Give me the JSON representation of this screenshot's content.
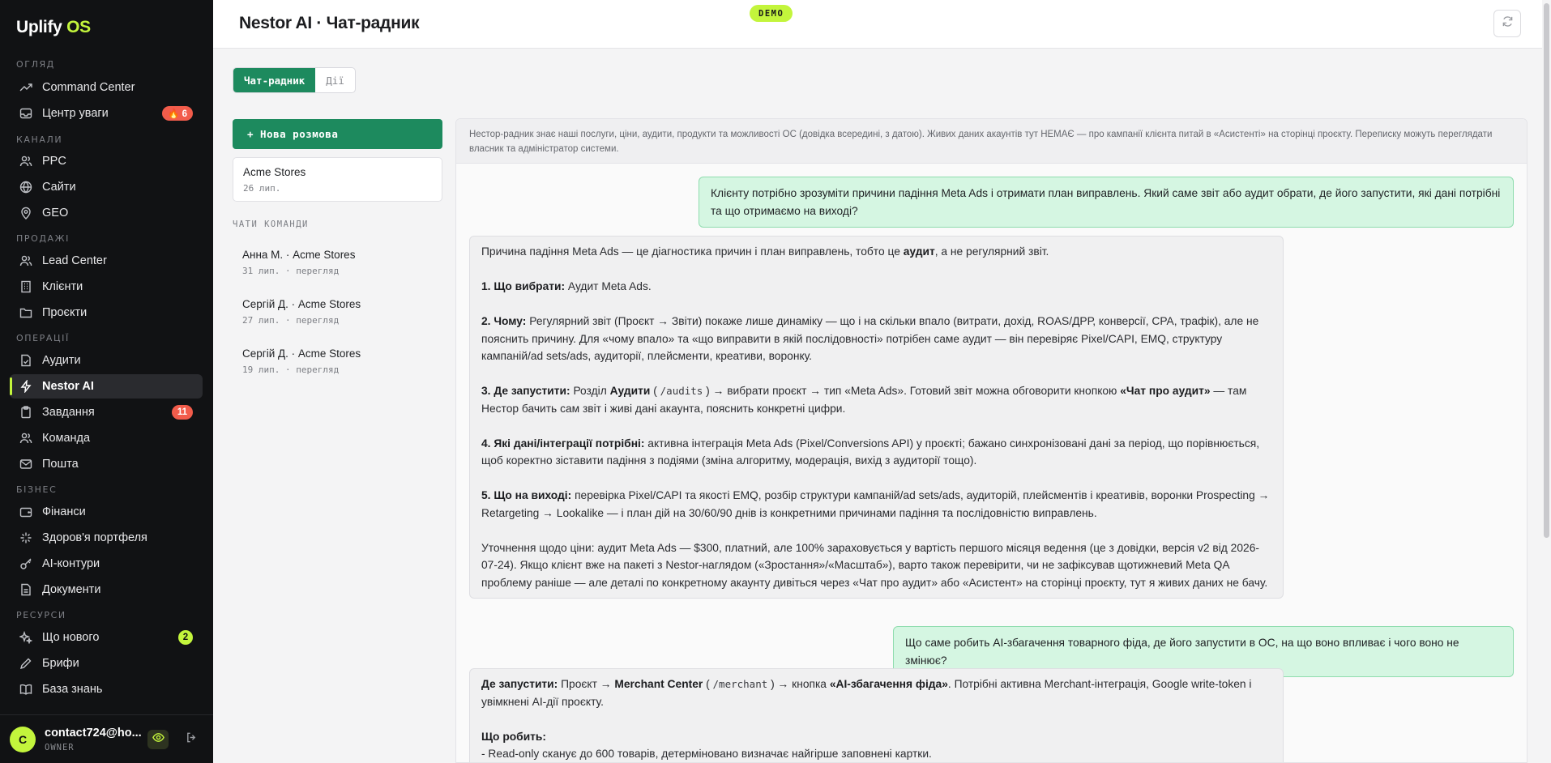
{
  "brand": {
    "name": "Uplify",
    "suffix": "OS"
  },
  "sidebar": {
    "sections": [
      {
        "label": "ОГЛЯД"
      },
      {
        "label": "КАНАЛИ"
      },
      {
        "label": "ПРОДАЖІ"
      },
      {
        "label": "ОПЕРАЦІЇ"
      },
      {
        "label": "БІЗНЕС"
      },
      {
        "label": "РЕСУРСИ"
      }
    ],
    "items": [
      {
        "label": "Command Center",
        "icon": "trending-up-icon"
      },
      {
        "label": "Центр уваги",
        "icon": "inbox-icon",
        "badge": "🔥 6"
      },
      {
        "label": "PPC",
        "icon": "users-icon"
      },
      {
        "label": "Сайти",
        "icon": "globe-icon"
      },
      {
        "label": "GEO",
        "icon": "map-pin-icon"
      },
      {
        "label": "Lead Center",
        "icon": "users-icon"
      },
      {
        "label": "Клієнти",
        "icon": "building-icon"
      },
      {
        "label": "Проєкти",
        "icon": "folder-icon"
      },
      {
        "label": "Аудити",
        "icon": "file-check-icon"
      },
      {
        "label": "Nestor AI",
        "icon": "bolt-icon",
        "active": true
      },
      {
        "label": "Завдання",
        "icon": "clipboard-icon",
        "badge": "11"
      },
      {
        "label": "Команда",
        "icon": "users-icon"
      },
      {
        "label": "Пошта",
        "icon": "mail-icon"
      },
      {
        "label": "Фінанси",
        "icon": "wallet-icon"
      },
      {
        "label": "Здоров'я портфеля",
        "icon": "sparkle-icon"
      },
      {
        "label": "AI-контури",
        "icon": "key-icon"
      },
      {
        "label": "Документи",
        "icon": "document-icon"
      },
      {
        "label": "Що нового",
        "icon": "sparkles-icon",
        "badge": "2"
      },
      {
        "label": "Брифи",
        "icon": "edit-icon"
      },
      {
        "label": "База знань",
        "icon": "book-icon"
      }
    ]
  },
  "account": {
    "initial": "C",
    "name": "contact724@ho...",
    "role": "OWNER"
  },
  "header": {
    "title": "Nestor AI · Чат-радник",
    "demo_label": "DEMO"
  },
  "tabs": [
    {
      "label": "Чат-радник",
      "active": true
    },
    {
      "label": "Дії",
      "active": false
    }
  ],
  "left": {
    "new_chat_label": "+ Нова розмова",
    "my_chat": {
      "title": "Acme Stores",
      "meta": "26 лип."
    },
    "team_label": "ЧАТИ КОМАНДИ",
    "team_chats": [
      {
        "title": "Анна М. · Acme Stores",
        "meta": "31 лип. · перегляд"
      },
      {
        "title": "Сергій Д. · Acme Stores",
        "meta": "27 лип. · перегляд"
      },
      {
        "title": "Сергій Д. · Acme Stores",
        "meta": "19 лип. · перегляд"
      }
    ]
  },
  "chat": {
    "notice": "Нестор-радник знає наші послуги, ціни, аудити, продукти та можливості ОС (довідка всередині, з датою). Живих даних акаунтів тут НЕМАЄ — про кампанії клієнта питай в «Асистенті» на сторінці проєкту. Переписку можуть переглядати власник та адміністратор системи.",
    "q1": "Клієнту потрібно зрозуміти причини падіння Meta Ads і отримати план виправлень. Який саме звіт або аудит обрати, де його запустити, які дані потрібні та що отримаємо на виході?",
    "a1": {
      "intro_pre": "Причина падіння Meta Ads — це діагностика причин і план виправлень, тобто це ",
      "intro_bold": "аудит",
      "intro_post": ", а не регулярний звіт.",
      "p1_label": "1. Що вибрати:",
      "p1_text": " Аудит Meta Ads.",
      "p2_label": "2. Чому:",
      "p2_text": " Регулярний звіт (Проєкт → Звіти) покаже лише динаміку — що і на скільки впало (витрати, дохід, ROAS/ДРР, конверсії, CPA, трафік), але не пояснить причину. Для «чому впало» та «що виправити в якій послідовності» потрібен саме аудит — він перевіряє Pixel/CAPI, EMQ, структуру кампаній/ad sets/ads, аудиторії, плейсменти, креативи, воронку.",
      "p3_label": "3. Де запустити:",
      "p3_a": " Розділ ",
      "p3_bold1": "Аудити",
      "p3_code": "/audits",
      "p3_b": " → вибрати проєкт → тип «Meta Ads». Готовий звіт можна обговорити кнопкою ",
      "p3_bold2": "«Чат про аудит»",
      "p3_c": " — там Нестор бачить сам звіт і живі дані акаунта, пояснить конкретні цифри.",
      "p4_label": "4. Які дані/інтеграції потрібні:",
      "p4_text": " активна інтеграція Meta Ads (Pixel/Conversions API) у проєкті; бажано синхронізовані дані за період, що порівнюється, щоб коректно зіставити падіння з подіями (зміна алгоритму, модерація, вихід з аудиторії тощо).",
      "p5_label": "5. Що на виході:",
      "p5_text": " перевірка Pixel/CAPI та якості EMQ, розбір структури кампаній/ad sets/ads, аудиторій, плейсментів і креативів, воронки Prospecting → Retargeting → Lookalike — і план дій на 30/60/90 днів із конкретними причинами падіння та послідовністю виправлень.",
      "p6_text": "Уточнення щодо ціни: аудит Meta Ads — $300, платний, але 100% зараховується у вартість першого місяця ведення (це з довідки, версія v2 від 2026-07-24). Якщо клієнт вже на пакеті з Nestor-наглядом («Зростання»/«Масштаб»), варто також перевірити, чи не зафіксував щотижневий Meta QA проблему раніше — але деталі по конкретному акаунту дивіться через «Чат про аудит» або «Асистент» на сторінці проєкту, тут я живих даних не бачу."
    },
    "q2": "Що саме робить AI-збагачення товарного фіда, де його запустити в ОС, на що воно впливає і чого воно не змінює?",
    "a2": {
      "l1_label": "Де запустити:",
      "l1_a": " Проєкт → ",
      "l1_bold1": "Merchant Center",
      "l1_code": "/merchant",
      "l1_b": " → кнопка ",
      "l1_bold2": "«AI-збагачення фіда»",
      "l1_c": ". Потрібні активна Merchant-інтеграція, Google write-token і увімкнені AI-дії проєкту.",
      "l2_label": "Що робить:",
      "l3_text": "- Read-only сканує до 600 товарів, детерміновано визначає найгірше заповнені картки."
    }
  }
}
